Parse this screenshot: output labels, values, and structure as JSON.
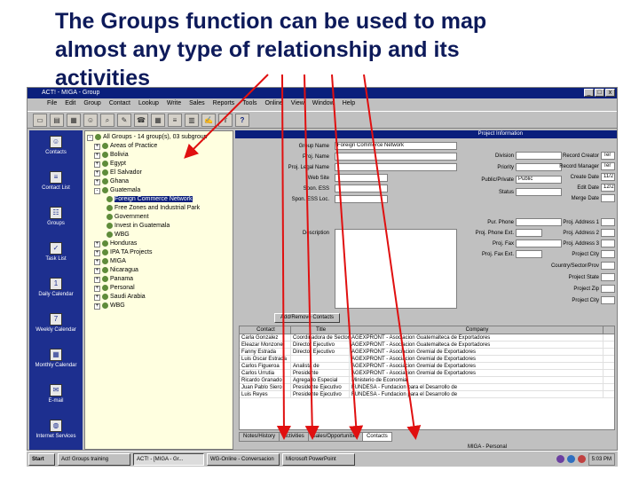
{
  "slide": {
    "title_line1": "The Groups function can be used to map",
    "title_line2": "almost any type of relationship and its",
    "title_line3": "activities"
  },
  "window": {
    "title": "ACT! - MIGA - Group",
    "controls": [
      "_",
      "□",
      "x"
    ]
  },
  "menu": [
    "File",
    "Edit",
    "Group",
    "Contact",
    "Lookup",
    "Write",
    "Sales",
    "Reports",
    "Tools",
    "Online",
    "View",
    "Window",
    "Help"
  ],
  "toolbar": {
    "icons": [
      "folder-icon",
      "save-icon",
      "print-icon",
      "group-icon",
      "lookup-icon",
      "note-icon",
      "phone-icon",
      "calendar-icon",
      "list-icon",
      "chart-icon",
      "write-icon",
      "export-icon",
      "help-icon"
    ],
    "glyphs": [
      "▭",
      "▤",
      "▦",
      "☺",
      "⌕",
      "✎",
      "☎",
      "▦",
      "≡",
      "▥",
      "✍",
      "⇪",
      "?"
    ]
  },
  "sidebar": {
    "items": [
      {
        "label": "Contacts",
        "icon": "contacts-icon",
        "glyph": "☺"
      },
      {
        "label": "Contact List",
        "icon": "contact-list-icon",
        "glyph": "≡"
      },
      {
        "label": "Groups",
        "icon": "groups-icon",
        "glyph": "☷"
      },
      {
        "label": "Task List",
        "icon": "task-list-icon",
        "glyph": "✓"
      },
      {
        "label": "Daily Calendar",
        "icon": "daily-calendar-icon",
        "glyph": "1"
      },
      {
        "label": "Weekly Calendar",
        "icon": "weekly-calendar-icon",
        "glyph": "7"
      },
      {
        "label": "Monthly Calendar",
        "icon": "monthly-calendar-icon",
        "glyph": "▦"
      },
      {
        "label": "E-mail",
        "icon": "email-icon",
        "glyph": "✉"
      },
      {
        "label": "Internet Services",
        "icon": "internet-services-icon",
        "glyph": "◍"
      }
    ]
  },
  "tree": {
    "root": "All Groups - 14 group(s), 03 subgroup",
    "items": [
      {
        "label": "Areas of Practice",
        "level": 1,
        "expander": "+"
      },
      {
        "label": "Bolivia",
        "level": 1,
        "expander": "+"
      },
      {
        "label": "Egypt",
        "level": 1,
        "expander": "+"
      },
      {
        "label": "El Salvador",
        "level": 1,
        "expander": "+"
      },
      {
        "label": "Ghana",
        "level": 1,
        "expander": "+"
      },
      {
        "label": "Guatemala",
        "level": 1,
        "expander": "-"
      },
      {
        "label": "Foreign Commerce Network",
        "level": 2,
        "expander": "",
        "selected": true
      },
      {
        "label": "Free Zones and Industrial Park",
        "level": 2,
        "expander": ""
      },
      {
        "label": "Government",
        "level": 2,
        "expander": ""
      },
      {
        "label": "Invest in Guatemala",
        "level": 2,
        "expander": ""
      },
      {
        "label": "WBG",
        "level": 2,
        "expander": ""
      },
      {
        "label": "Honduras",
        "level": 1,
        "expander": "+"
      },
      {
        "label": "IPA TA Projects",
        "level": 1,
        "expander": "+"
      },
      {
        "label": "MIGA",
        "level": 1,
        "expander": "+"
      },
      {
        "label": "Nicaragua",
        "level": 1,
        "expander": "+"
      },
      {
        "label": "Panama",
        "level": 1,
        "expander": "+"
      },
      {
        "label": "Personal",
        "level": 1,
        "expander": "+"
      },
      {
        "label": "Saudi Arabia",
        "level": 1,
        "expander": "+"
      },
      {
        "label": "WBG",
        "level": 1,
        "expander": "+"
      }
    ]
  },
  "panel": {
    "header": "Project Information",
    "left_fields": [
      {
        "label": "Group Name",
        "value": "Foreign Commerce Network"
      },
      {
        "label": "Proj. Name",
        "value": ""
      },
      {
        "label": "Proj. Legal Name",
        "value": ""
      },
      {
        "label": "Web Site",
        "value": ""
      },
      {
        "label": "Spon. ESS",
        "value": ""
      },
      {
        "label": "Spon. ESS Loc.",
        "value": ""
      },
      {
        "label": "Description",
        "value": ""
      }
    ],
    "mid_fields": [
      {
        "label": "Division",
        "value": ""
      },
      {
        "label": "Priority",
        "value": ""
      },
      {
        "label": "Public/Private",
        "value": "Public"
      },
      {
        "label": "Status",
        "value": ""
      },
      {
        "label": "Pur. Phone",
        "value": ""
      },
      {
        "label": "Proj. Phone Ext.",
        "value": ""
      },
      {
        "label": "Proj. Fax",
        "value": ""
      },
      {
        "label": "Proj. Fax Ext.",
        "value": ""
      }
    ],
    "right_fields": [
      {
        "label": "Record Creator",
        "value": "Ter"
      },
      {
        "label": "Record Manager",
        "value": "Ter"
      },
      {
        "label": "Create Date",
        "value": "11/2"
      },
      {
        "label": "Edit Date",
        "value": "12/2"
      },
      {
        "label": "Merge Date",
        "value": ""
      },
      {
        "label": "Proj. Address 1",
        "value": ""
      },
      {
        "label": "Proj. Address 2",
        "value": ""
      },
      {
        "label": "Proj. Address 3",
        "value": ""
      },
      {
        "label": "Project City",
        "value": ""
      },
      {
        "label": "Country/Sector/Prov",
        "value": ""
      },
      {
        "label": "Project State",
        "value": ""
      },
      {
        "label": "Project Zip",
        "value": ""
      },
      {
        "label": "Project City",
        "value": ""
      }
    ],
    "add_remove_button": "Add/Remove Contacts"
  },
  "grid": {
    "columns": [
      "Contact",
      "Title",
      "Company"
    ],
    "rows": [
      [
        "Carla Gonzalez",
        "Coordinadora de Sectores de Fide",
        "AGEXPRONT - Asociacion Guatemalteca de Exportadores"
      ],
      [
        "Eleazar Monzonel",
        "Director Ejecutivo",
        "AGEXPRONT - Asociacion Guatemalteca de Exportadores"
      ],
      [
        "Fanny Estrada",
        "Director Ejecutivo",
        "AGEXPRONT - Asociacion Gremial de Exportadores"
      ],
      [
        "Luis Oscar Estrada",
        "",
        "AGEXPRONT - Asociacion Gremial de Exportadores"
      ],
      [
        "Carlos Figueroa",
        "Analista de",
        "AGEXPRONT - Asociacion Gremial de Exportadores"
      ],
      [
        "Carlos Urrutia",
        "Presidente",
        "AGEXPRONT - Asociacion Gremial de Exportadores"
      ],
      [
        "Ricardo Granado",
        "Agregado Especial",
        "Ministerio de Economia"
      ],
      [
        "Juan Pablo Siero",
        "Presidente Ejecutivo",
        "FUNDESA - Fundacion para el Desarrollo de"
      ],
      [
        "Luis Reyes",
        "Presidente Ejecutivo",
        "FUNDESA - Fundacion para el Desarrollo de"
      ]
    ]
  },
  "tabs": [
    "Notes/History",
    "Activities",
    "Sales/Opportunities",
    "Contacts"
  ],
  "status": {
    "left": "",
    "right": "MIGA - Personal"
  },
  "taskbar": {
    "start": "Start",
    "tasks": [
      "Act! Groups training",
      "ACT! - [MIGA - Gr...",
      "WG-Online - Conversacion",
      "Microsoft PowerPoint"
    ],
    "clock": "5:03 PM"
  }
}
